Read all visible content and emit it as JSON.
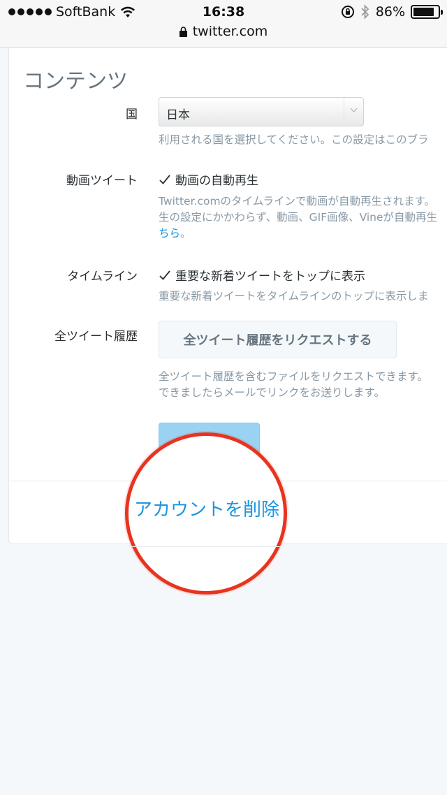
{
  "status_bar": {
    "carrier": "SoftBank",
    "time": "16:38",
    "battery": "86%",
    "battery_level": 0.86,
    "url": "twitter.com"
  },
  "content": {
    "section_title": "コンテンツ",
    "country": {
      "label": "国",
      "selected": "日本",
      "help": "利用される国を選択してください。この設定はこのブラ"
    },
    "video_tweet": {
      "label": "動画ツイート",
      "checkbox_label": "動画の自動再生",
      "help_line1": "Twitter.comのタイムラインで動画が自動再生されます。",
      "help_line2": "生の設定にかかわらず、動画、GIF画像、Vineが自動再生",
      "help_link": "ちら",
      "help_line3_suffix": "。"
    },
    "timeline": {
      "label": "タイムライン",
      "checkbox_label": "重要な新着ツイートをトップに表示",
      "help": "重要な新着ツイートをタイムラインのトップに表示しま"
    },
    "archive": {
      "label": "全ツイート履歴",
      "button": "全ツイート履歴をリクエストする",
      "help_line1": "全ツイート履歴を含むファイルをリクエストできます。",
      "help_line2": "できましたらメールでリンクをお送りします。"
    },
    "delete_account": "アカウントを削除"
  }
}
